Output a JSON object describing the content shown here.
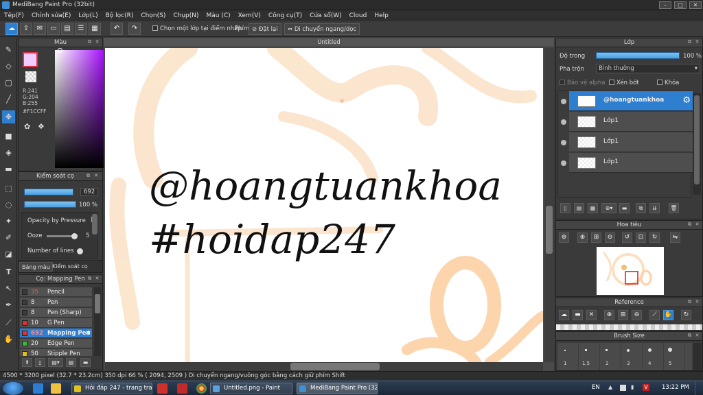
{
  "window": {
    "title": "MediBang Paint Pro (32bit)",
    "min": "–",
    "max": "□",
    "close": "✕"
  },
  "menu": [
    "Tệp(F)",
    "Chỉnh sửa(E)",
    "Lớp(L)",
    "Bộ lọc(R)",
    "Chọn(S)",
    "Chụp(N)",
    "Màu (C)",
    "Xem(V)",
    "Công cụ(T)",
    "Cửa sổ(W)",
    "Cloud",
    "Help"
  ],
  "toolbar": {
    "select_layer_label": "Chọn một lớp tại điểm nhấp",
    "key_label": "Phím",
    "reset_label": "Đặt lại",
    "move_label": "Di chuyển ngang/dọc"
  },
  "color_panel": {
    "title": "Màu",
    "r": "R:241",
    "g": "G:204",
    "b": "B:255",
    "hex": "#F1CCFF",
    "primary": "#f1ccff"
  },
  "brush_control": {
    "title": "Kiểm soát cọ",
    "size": "692",
    "opacity": "100 %",
    "size_fraction": 0.95,
    "opacity_fraction": 1.0,
    "opacity_by_pressure": "Opacity by Pressure",
    "ooze_label": "Ooze",
    "ooze_value": "5",
    "num_lines_label": "Number of lines",
    "tab_palette": "Bảng màu",
    "tab_brush": "Kiểm soát cọ"
  },
  "brush_list": {
    "title": "Cọ: Mapping Pen",
    "items": [
      {
        "size": "35",
        "name": "Pencil",
        "color": "#3a3a3a"
      },
      {
        "size": "8",
        "name": "Pen",
        "color": "#3a3a3a"
      },
      {
        "size": "8",
        "name": "Pen (Sharp)",
        "color": "#3a3a3a"
      },
      {
        "size": "10",
        "name": "G Pen",
        "color": "#e03030"
      },
      {
        "size": "692",
        "name": "Mapping Pen",
        "color": "#e03030"
      },
      {
        "size": "20",
        "name": "Edge Pen",
        "color": "#30c030"
      },
      {
        "size": "50",
        "name": "Stipple Pen",
        "color": "#e0c020"
      }
    ]
  },
  "document": {
    "tab": "Untitled",
    "text_line1": "@hoangtuankhoa",
    "text_line2": "#hoidap247"
  },
  "layers": {
    "title": "Lớp",
    "opacity_label": "Độ trong",
    "opacity_value": "100 %",
    "blend_label": "Pha trộn",
    "blend_value": "Bình thường",
    "protect_alpha": "Bảo vệ alpha",
    "clipping": "Xén bớt",
    "lock": "Khóa",
    "items": [
      {
        "name": "@hoangtuankhoa"
      },
      {
        "name": "Lớp1"
      },
      {
        "name": "Lớp1"
      },
      {
        "name": "Lớp1"
      }
    ]
  },
  "navigator": {
    "title": "Hoa tiêu"
  },
  "reference": {
    "title": "Reference"
  },
  "brush_size": {
    "title": "Brush Size",
    "sizes": [
      "1",
      "1.5",
      "2",
      "3",
      "4",
      "5"
    ]
  },
  "status": "4500 * 3200 pixel   (32.7 * 23.2cm)   350 dpi   66 %   ( 2094, 2509 )   Di chuyển ngang/vuông góc bằng cách giữ phím Shift",
  "taskbar": {
    "items": [
      "Hỏi đáp 247 - trang tra ...",
      "Untitled.png - Paint",
      "MediBang Paint Pro (32..."
    ],
    "lang": "EN",
    "time": "13:22 PM"
  }
}
